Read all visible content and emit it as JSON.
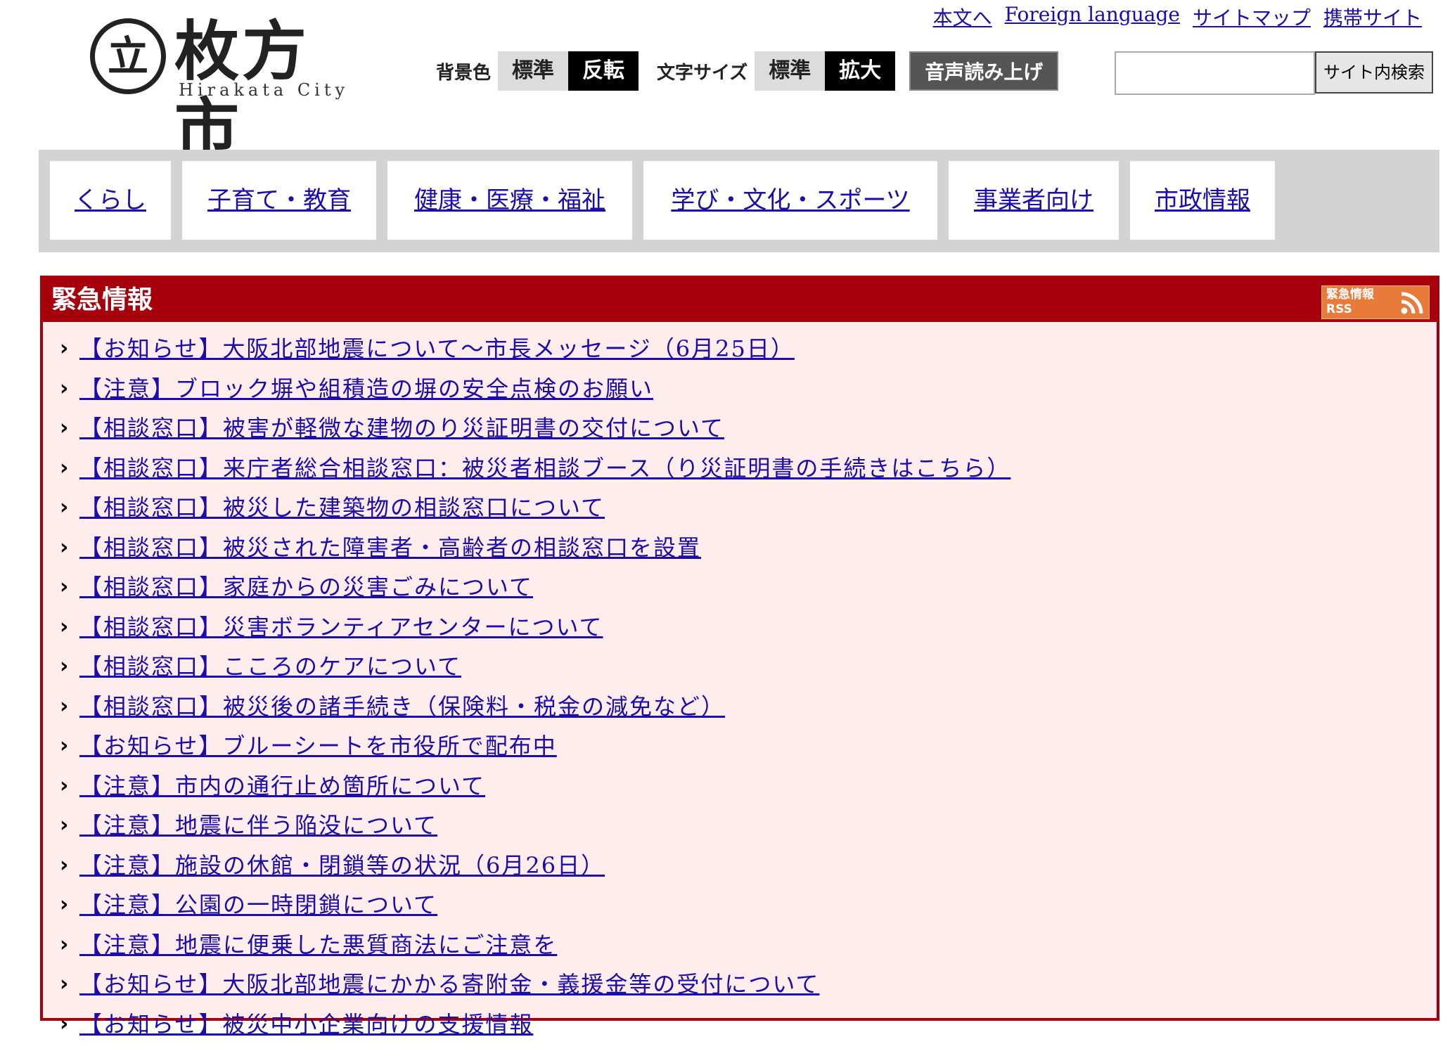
{
  "header": {
    "logo_mark": "立",
    "logo_title": "枚方市",
    "logo_sub": "Hirakata City",
    "top_links": [
      "本文へ",
      "Foreign language",
      "サイトマップ",
      "携帯サイト"
    ],
    "bg_label": "背景色",
    "bg_standard": "標準",
    "bg_invert": "反転",
    "font_label": "文字サイズ",
    "font_standard": "標準",
    "font_large": "拡大",
    "voice": "音声読み上げ",
    "search_value": "",
    "search_button": "サイト内検索"
  },
  "nav": [
    "くらし",
    "子育て・教育",
    "健康・医療・福祉",
    "学び・文化・スポーツ",
    "事業者向け",
    "市政情報"
  ],
  "emergency": {
    "title": "緊急情報",
    "rss_line1": "緊急情報",
    "rss_line2": "RSS",
    "chevron": "›",
    "items": [
      "【お知らせ】大阪北部地震について～市長メッセージ（6月25日）",
      "【注意】ブロック塀や組積造の塀の安全点検のお願い",
      "【相談窓口】被害が軽微な建物のり災証明書の交付について",
      "【相談窓口】来庁者総合相談窓口：被災者相談ブース（り災証明書の手続きはこちら）",
      "【相談窓口】被災した建築物の相談窓口について",
      "【相談窓口】被災された障害者・高齢者の相談窓口を設置",
      "【相談窓口】家庭からの災害ごみについて",
      "【相談窓口】災害ボランティアセンターについて",
      "【相談窓口】こころのケアについて",
      "【相談窓口】被災後の諸手続き（保険料・税金の減免など）",
      "【お知らせ】ブルーシートを市役所で配布中",
      "【注意】市内の通行止め箇所について",
      "【注意】地震に伴う陥没について",
      "【注意】施設の休館・閉鎖等の状況（6月26日）",
      "【注意】公園の一時閉鎖について",
      "【注意】地震に便乗した悪質商法にご注意を",
      "【お知らせ】大阪北部地震にかかる寄附金・義援金等の受付について",
      "【お知らせ】被災中小企業向けの支援情報"
    ]
  },
  "colors": {
    "link": "#1a0dab",
    "emergency_red": "#a6000d",
    "emergency_bg": "#ffecec",
    "nav_bg": "#d3d3d3"
  }
}
